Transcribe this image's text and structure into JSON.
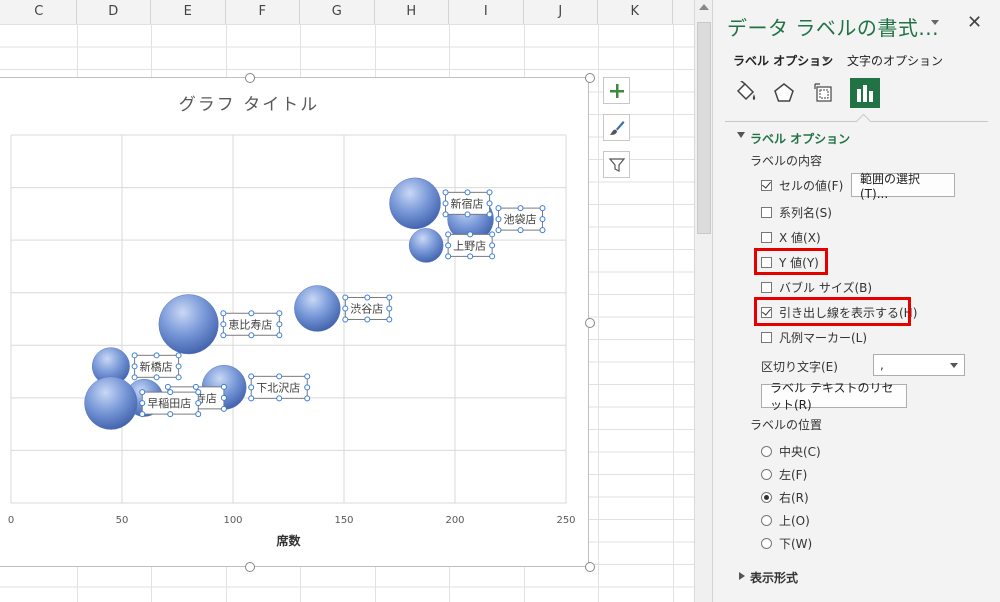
{
  "sheet": {
    "columns": [
      "C",
      "D",
      "E",
      "F",
      "G",
      "H",
      "I",
      "J",
      "K"
    ]
  },
  "chart": {
    "side_buttons": [
      "plus-icon",
      "brush-icon",
      "filter-icon"
    ]
  },
  "chart_data": {
    "type": "scatter",
    "title": "グラフ タイトル",
    "xlabel": "席数",
    "ylabel": "",
    "xlim": [
      0,
      250
    ],
    "xticks": [
      "0",
      "50",
      "100",
      "150",
      "200",
      "250"
    ],
    "points": [
      {
        "label": "新宿店",
        "x": 182,
        "y": 285,
        "size": 30
      },
      {
        "label": "池袋店",
        "x": 207,
        "y": 270,
        "size": 27
      },
      {
        "label": "上野店",
        "x": 187,
        "y": 245,
        "size": 20
      },
      {
        "label": "渋谷店",
        "x": 138,
        "y": 185,
        "size": 27
      },
      {
        "label": "恵比寿店",
        "x": 80,
        "y": 170,
        "size": 35
      },
      {
        "label": "新橋店",
        "x": 45,
        "y": 130,
        "size": 22
      },
      {
        "label": "下北沢店",
        "x": 96,
        "y": 110,
        "size": 26
      },
      {
        "label": "吉祥寺店",
        "x": 60,
        "y": 100,
        "size": 22
      },
      {
        "label": "早稲田店",
        "x": 45,
        "y": 95,
        "size": 31
      }
    ],
    "ylim": [
      0,
      350
    ],
    "grid": true,
    "legend": "none"
  },
  "pane": {
    "title": "データ ラベルの書式...",
    "tab_label_options": "ラベル オプション",
    "tab_text_options": "文字のオプション",
    "icons": [
      "fill-line-icon",
      "effects-icon",
      "size-properties-icon",
      "chart-options-icon"
    ],
    "section_label_options": "ラベル オプション",
    "label_contains": "ラベルの内容",
    "options": [
      {
        "label": "セルの値(F)",
        "checked": true
      },
      {
        "label": "系列名(S)",
        "checked": false
      },
      {
        "label": "X 値(X)",
        "checked": false
      },
      {
        "label": "Y 値(Y)",
        "checked": false
      },
      {
        "label": "バブル サイズ(B)",
        "checked": false
      },
      {
        "label": "引き出し線を表示する(H)",
        "checked": true
      },
      {
        "label": "凡例マーカー(L)",
        "checked": false
      }
    ],
    "select_range_button": "範囲の選択(T)...",
    "separator_label": "区切り文字(E)",
    "separator_value": ",",
    "reset_button": "ラベル テキストのリセット(R)",
    "label_position": "ラベルの位置",
    "positions": [
      {
        "label": "中央(C)",
        "checked": false
      },
      {
        "label": "左(F)",
        "checked": false
      },
      {
        "label": "右(R)",
        "checked": true
      },
      {
        "label": "上(O)",
        "checked": false
      },
      {
        "label": "下(W)",
        "checked": false
      }
    ],
    "section_number": "表示形式",
    "highlight_color": "#e50000",
    "accent_color": "#217346"
  }
}
